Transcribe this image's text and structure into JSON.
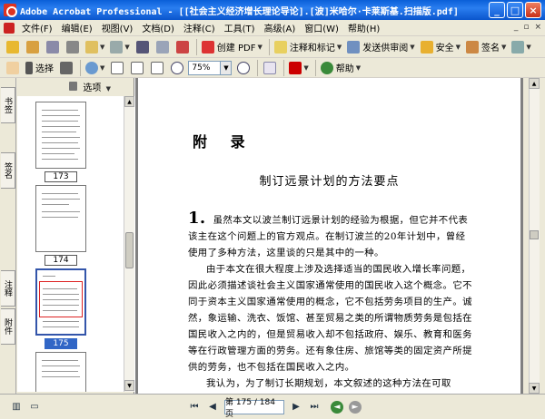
{
  "window": {
    "title": "Adobe Acrobat Professional - [[社会主义经济增长理论导论].[波]米哈尔·卡莱斯基.扫描版.pdf]",
    "controls": [
      "_",
      "□",
      "×"
    ]
  },
  "menubar": {
    "items": [
      "文件(F)",
      "编辑(E)",
      "视图(V)",
      "文档(D)",
      "注释(C)",
      "工具(T)",
      "高级(A)",
      "窗口(W)",
      "帮助(H)"
    ],
    "right": [
      "_",
      "▫",
      "×"
    ]
  },
  "toolbar1": {
    "create_pdf": "创建 PDF",
    "comment": "注释和标记",
    "send": "发送供审阅",
    "secure": "安全",
    "sign": "签名"
  },
  "toolbar2": {
    "select": "选择",
    "zoom_value": "75%",
    "help": "帮助"
  },
  "leftpanel": {
    "tabs": [
      "书签",
      "签名",
      "注释",
      "附件"
    ],
    "options_label": "选项",
    "thumbnails": [
      {
        "label": "173",
        "selected": false
      },
      {
        "label": "174",
        "selected": false
      },
      {
        "label": "175",
        "selected": true
      }
    ]
  },
  "document": {
    "heading": "附 录",
    "subtitle": "制订远景计划的方法要点",
    "para1_num": "1.",
    "para1": "虽然本文以波兰制订远景计划的经验为根据，但它并不代表该主在这个问题上的官方观点。在制订波兰的20年计划中，曾经使用了多种方法，这里谈的只是其中的一种。",
    "para2": "由于本文在很大程度上涉及选择适当的国民收入增长率问题，因此必须描述谈社会主义国家通常使用的国民收入这个概念。它不同于资本主义国家通常使用的概念，它不包括劳务项目的生产。诚然，象运输、洗衣、饭馆、甚至贸易之类的所谓物质劳务是包括在国民收入之内的，但是贸易收入却不包括政府、娱乐、教育和医务等在行政管理方面的劳务。还有象住房、旅馆等类的固定资产所提供的劳务，也不包括在国民收入之内。",
    "para3": "我认为，为了制订长期规划，本文叙述的这种方法在可取"
  },
  "statusbar": {
    "page_display": "第 175 / 184 页"
  }
}
